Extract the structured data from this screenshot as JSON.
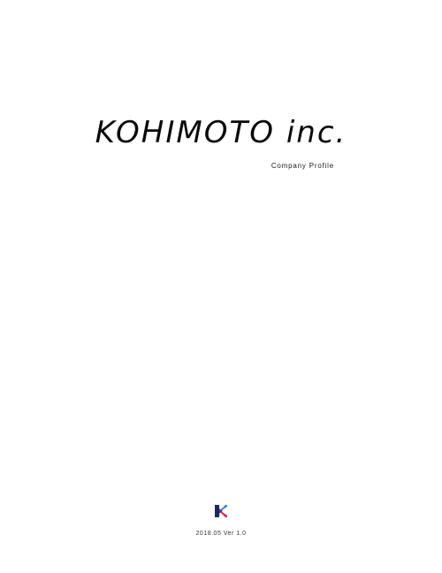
{
  "document": {
    "title": "KOHIMOTO inc.",
    "subtitle": "Company Profile",
    "version": "2018.05  Ver 1.0",
    "logo_icon": "kohimoto-k-logo-icon"
  },
  "colors": {
    "logo_dark": "#1a2a5c",
    "logo_red": "#e6194b",
    "logo_blue": "#2f8bd8",
    "text": "#0a0a0a",
    "background": "#ffffff"
  }
}
